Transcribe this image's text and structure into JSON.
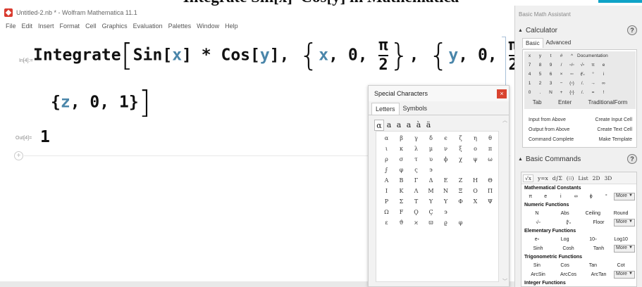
{
  "caption": {
    "text": "Integrate Sin[x]*Cos[y] in Mathematica"
  },
  "notebook": {
    "title": "Untitled-2.nb * - Wolfram Mathematica 11.1",
    "menu": [
      "File",
      "Edit",
      "Insert",
      "Format",
      "Cell",
      "Graphics",
      "Evaluation",
      "Palettes",
      "Window",
      "Help"
    ],
    "in_label": "In[4]:=",
    "out_label": "Out[4]=",
    "input": {
      "fn": "Integrate",
      "sin": "Sin",
      "x": "x",
      "times": "*",
      "cos": "Cos",
      "y": "y",
      "zero": "0",
      "pi": "π",
      "two": "2",
      "z": "z",
      "one": "1"
    },
    "output": "1",
    "add_cell": "+"
  },
  "special_characters": {
    "title": "Special Characters",
    "close": "×",
    "tabs": [
      "Letters",
      "Symbols"
    ],
    "styles": [
      "α",
      "a",
      "a",
      "a",
      "à",
      "ä"
    ],
    "grid": [
      [
        "α",
        "β",
        "γ",
        "δ",
        "ϵ",
        "ζ",
        "η",
        "θ"
      ],
      [
        "ι",
        "κ",
        "λ",
        "μ",
        "ν",
        "ξ",
        "ο",
        "π"
      ],
      [
        "ρ",
        "σ",
        "τ",
        "υ",
        "ϕ",
        "χ",
        "ψ",
        "ω"
      ],
      [
        "ϝ",
        "φ",
        "ς",
        "϶",
        "",
        "",
        "",
        ""
      ],
      [
        "A",
        "B",
        "Γ",
        "Δ",
        "E",
        "Z",
        "H",
        "Θ"
      ],
      [
        "I",
        "K",
        "Λ",
        "M",
        "N",
        "Ξ",
        "O",
        "Π"
      ],
      [
        "P",
        "Σ",
        "T",
        "Y",
        "Y",
        "Φ",
        "X",
        "Ψ"
      ],
      [
        "Ω",
        "F",
        "Ϙ",
        "Ç",
        "϶",
        "",
        "",
        ""
      ],
      [
        "ε",
        "ϑ",
        "ϰ",
        "ϖ",
        "ϱ",
        "φ",
        "",
        ""
      ]
    ]
  },
  "assistant": {
    "title": "Basic Math Assistant",
    "calculator": {
      "heading": "Calculator",
      "help": "?",
      "tabs": [
        "Basic",
        "Advanced"
      ],
      "keypad": [
        [
          "x",
          "y",
          "t",
          "#",
          "^",
          "Documentation"
        ],
        [
          "7",
          "8",
          "9",
          "/",
          "▫/▫",
          "√▫",
          "π",
          "e"
        ],
        [
          "4",
          "5",
          "6",
          "×",
          "▫▫",
          "∜▫",
          "°",
          "i"
        ],
        [
          "1",
          "2",
          "3",
          "−",
          "(▫)",
          "/.",
          "→",
          "∞"
        ],
        [
          "0",
          ".",
          "N",
          "+",
          "{▫}",
          "/.",
          "=",
          "!"
        ]
      ],
      "keypad_bottom": [
        "Tab",
        "Enter",
        "TraditionalForm"
      ],
      "commands": [
        [
          "Input from Above",
          "Create Input Cell"
        ],
        [
          "Output from Above",
          "Create Text Cell"
        ],
        [
          "Command Complete",
          "Make Template"
        ]
      ]
    },
    "basic_commands": {
      "heading": "Basic Commands",
      "help": "?",
      "tabs": [
        "√x",
        "y=x",
        "d∫Σ",
        "(⁝⁝)",
        "List",
        "2D",
        "3D"
      ],
      "sections": [
        {
          "title": "Mathematical Constants",
          "rows": [
            [
              "π",
              "e",
              "i",
              "∞",
              "ϕ",
              "°",
              "More"
            ]
          ]
        },
        {
          "title": "Numeric Functions",
          "rows": [
            [
              "N",
              "Abs",
              "Ceiling",
              "Round"
            ],
            [
              "√▫",
              "∜▫",
              "Floor",
              "More"
            ]
          ]
        },
        {
          "title": "Elementary Functions",
          "rows": [
            [
              "e▫",
              "Log",
              "10▫",
              "Log10"
            ],
            [
              "Sinh",
              "Cosh",
              "Tanh",
              "More"
            ]
          ]
        },
        {
          "title": "Trigonometric Functions",
          "rows": [
            [
              "Sin",
              "Cos",
              "Tan",
              "Cot"
            ],
            [
              "ArcSin",
              "ArcCos",
              "ArcTan",
              "More"
            ]
          ]
        },
        {
          "title": "Integer Functions",
          "rows": []
        }
      ]
    }
  }
}
